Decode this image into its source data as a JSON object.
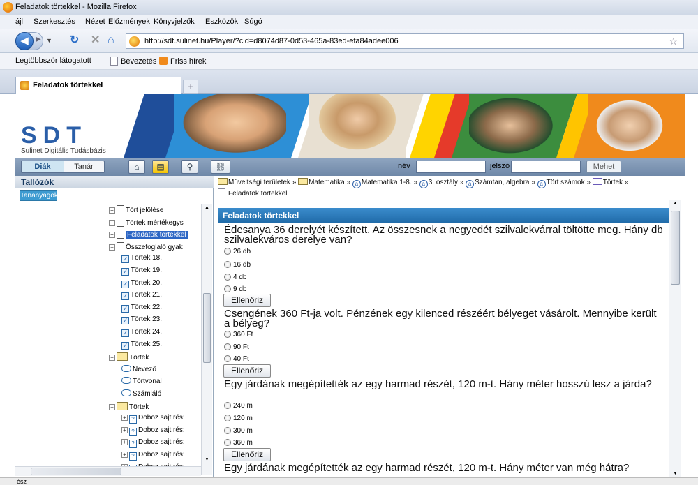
{
  "window": {
    "title": "Feladatok törtekkel - Mozilla Firefox"
  },
  "menu": [
    "ájl",
    "Szerkesztés",
    "Nézet",
    "Előzmények",
    "Könyvjelzők",
    "Eszközök",
    "Súgó"
  ],
  "nav": {
    "url": "http://sdt.sulinet.hu/Player/?cid=d8074d87-0d53-465a-83ed-efa84adee006"
  },
  "bookmarks": [
    "Legtöbbször látogatott",
    "Bevezetés",
    "Friss hírek"
  ],
  "tab": {
    "label": "Feladatok törtekkel"
  },
  "banner": {
    "logo_text": "SDT",
    "logo_sub": "Sulinet Digitális Tudásbázis"
  },
  "toolbar": {
    "role_student": "Diák",
    "role_teacher": "Tanár",
    "nev_label": "név",
    "jelszo_label": "jelszó",
    "go_button": "Mehet"
  },
  "left": {
    "title": "Tallózók",
    "tab": "Tananyagok"
  },
  "tree": [
    {
      "label": "Tört jelölése",
      "type": "page",
      "pm": "+"
    },
    {
      "label": "Törtek mértékegys",
      "type": "page",
      "pm": "+"
    },
    {
      "label": "Feladatok törtekkel",
      "type": "page",
      "pm": "+",
      "selected": true
    },
    {
      "label": "Összefoglaló gyak",
      "type": "page",
      "pm": "-"
    },
    {
      "label": "Törtek 18.",
      "type": "check"
    },
    {
      "label": "Törtek 19.",
      "type": "check"
    },
    {
      "label": "Törtek 20.",
      "type": "check"
    },
    {
      "label": "Törtek 21.",
      "type": "check"
    },
    {
      "label": "Törtek 22.",
      "type": "check"
    },
    {
      "label": "Törtek 23.",
      "type": "check"
    },
    {
      "label": "Törtek 24.",
      "type": "check"
    },
    {
      "label": "Törtek 25.",
      "type": "check"
    },
    {
      "label": "Törtek",
      "type": "folder",
      "pm": "-"
    },
    {
      "label": "Nevező",
      "type": "bubble"
    },
    {
      "label": "Törtvonal",
      "type": "bubble"
    },
    {
      "label": "Számláló",
      "type": "bubble"
    },
    {
      "label": "Törtek",
      "type": "folder2",
      "pm": "-"
    },
    {
      "label": "Doboz sajt rés:",
      "type": "question",
      "pm": "+"
    },
    {
      "label": "Doboz sajt rés:",
      "type": "question",
      "pm": "+"
    },
    {
      "label": "Doboz sajt rés:",
      "type": "question",
      "pm": "+"
    },
    {
      "label": "Doboz sajt rés:",
      "type": "question",
      "pm": "+"
    },
    {
      "label": "Doboz sajt rés:",
      "type": "question",
      "pm": "+"
    }
  ],
  "breadcrumb": [
    "Műveltségi területek",
    "Matematika",
    "Matematika 1-8.",
    "3. osztály",
    "Számtan, algebra",
    "Tört számok",
    "Törtek",
    "Feladatok törtekkel"
  ],
  "content": {
    "header": "Feladatok törtekkel",
    "check_label": "Ellenőriz",
    "questions": [
      {
        "text": "Édesanya 36 derelyét készített. Az összesnek a negyedét szilvalekvárral töltötte meg. Hány db szilvalekváros derelye van?",
        "options": [
          "26 db",
          "16 db",
          "4 db",
          "9 db"
        ]
      },
      {
        "text": "Csengének 360 Ft-ja volt. Pénzének egy kilenced részéért bélyeget vásárolt. Mennyibe került a bélyeg?",
        "options": [
          "360 Ft",
          "90 Ft",
          "40 Ft"
        ]
      },
      {
        "text": "Egy járdának megépítették az egy harmad részét, 120 m-t. Hány méter hosszú lesz a járda?",
        "options": [
          "240 m",
          "120 m",
          "300 m",
          "360 m"
        ]
      },
      {
        "text": "Egy járdának megépítették az egy harmad részét, 120 m-t. Hány méter van még hátra?"
      }
    ]
  },
  "status": {
    "text": "ész"
  }
}
